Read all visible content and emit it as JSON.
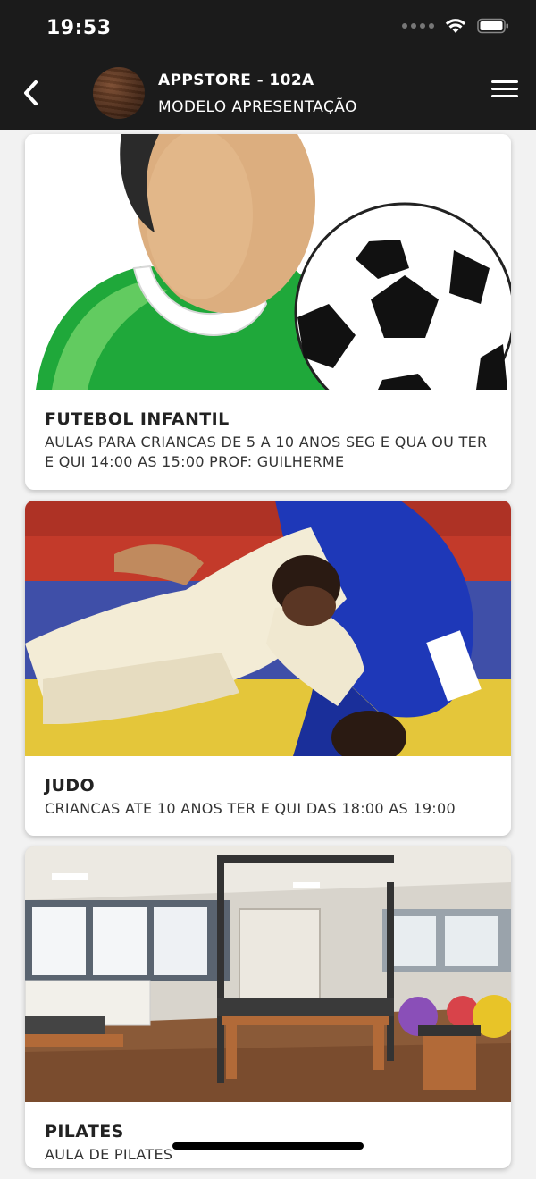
{
  "status_bar": {
    "time": "19:53"
  },
  "header": {
    "title": "APPSTORE - 102A",
    "subtitle": "MODELO APRESENTAÇÃO"
  },
  "cards": [
    {
      "title": "FUTEBOL INFANTIL",
      "description": "AULAS PARA CRIANCAS DE 5 A 10 ANOS SEG E QUA OU TER E QUI 14:00 AS 15:00 PROF: GUILHERME"
    },
    {
      "title": "JUDO",
      "description": "CRIANCAS ATE 10 ANOS TER E QUI DAS 18:00 AS 19:00"
    },
    {
      "title": "PILATES",
      "description": "AULA DE PILATES"
    }
  ]
}
